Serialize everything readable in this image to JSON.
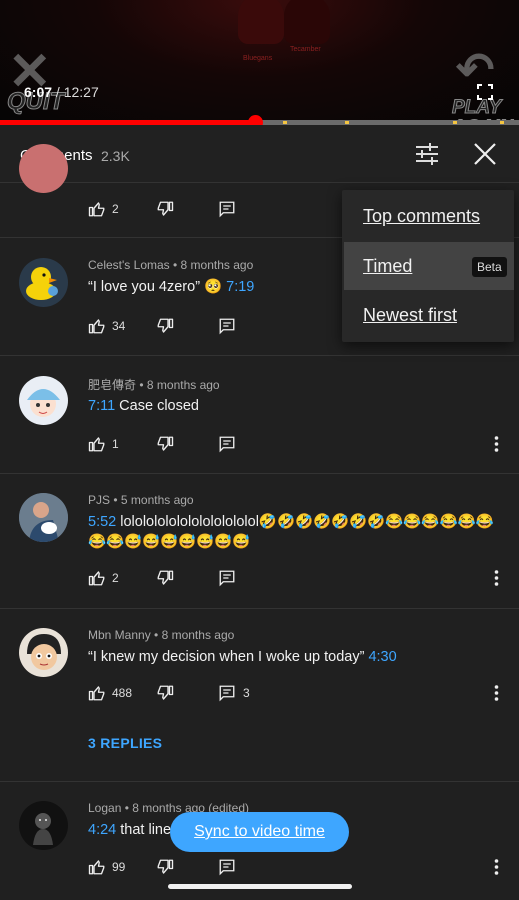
{
  "video": {
    "current_time": "6:07",
    "separator": " / ",
    "duration": "12:27",
    "overlay_left": "QUIT",
    "overlay_right": "PLAY AGAIN",
    "progress_fraction": 0.491,
    "tag_left": "Bluegans",
    "tag_right": "Tecamber"
  },
  "header": {
    "title": "Comments",
    "count": "2.3K"
  },
  "sort_menu": {
    "items": [
      {
        "label": "Top comments"
      },
      {
        "label": "Timed",
        "badge": "Beta",
        "selected": true
      },
      {
        "label": "Newest first"
      }
    ]
  },
  "comments": [
    {
      "likes": "2"
    },
    {
      "author": "Celest's Lomas",
      "age": "8 months ago",
      "text_before": "“I love you 4zero” 🥺 ",
      "timestamp": "7:19",
      "text_after": "",
      "likes": "34"
    },
    {
      "author": "肥皂傳奇",
      "age": "8 months ago",
      "timestamp": "7:11",
      "text_after": " Case closed",
      "likes": "1"
    },
    {
      "author": "PJS",
      "age": "5 months ago",
      "timestamp": "5:52",
      "text_after": " lolololololololololololol🤣🤣🤣🤣🤣🤣🤣😂😂😂😂😂😂😂😂😅😅😅😅😅😅😅",
      "likes": "2"
    },
    {
      "author": "Mbn Manny",
      "age": "8 months ago",
      "text_before": "“I knew my decision when I woke up today” ",
      "timestamp": "4:30",
      "likes": "488",
      "reply_count": "3",
      "replies_label": "3 REPLIES"
    },
    {
      "author": "Logan",
      "age": "8 months ago (edited)",
      "timestamp": "4:24",
      "text_after": " that line",
      "likes": "99"
    }
  ],
  "sync_button": "Sync to video time",
  "colors": {
    "accent_blue": "#3ea6ff",
    "progress_red": "#ff0000",
    "background": "#202020"
  }
}
